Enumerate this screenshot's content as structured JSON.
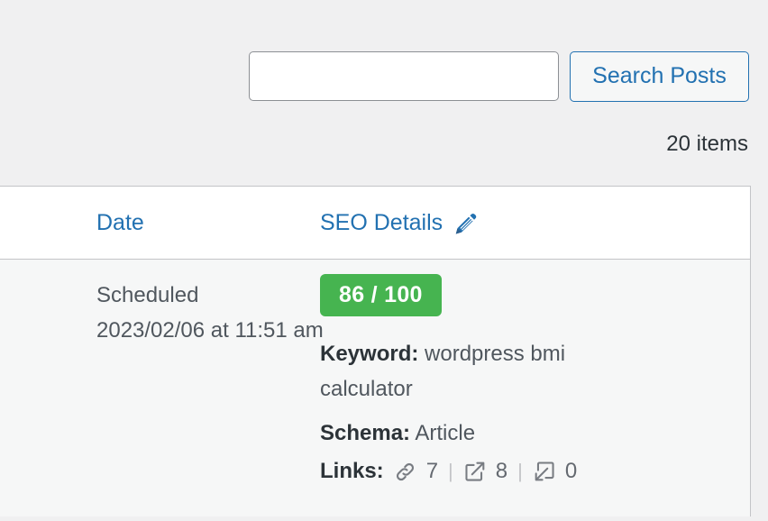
{
  "colors": {
    "page_background": "#f0f0f1",
    "link_blue": "#2271b1",
    "score_green": "#46b450",
    "border_gray": "#c3c4c7",
    "text_dark": "#2c3338",
    "text_gray": "#50575e"
  },
  "search": {
    "value": "",
    "placeholder": "",
    "button_label": "Search Posts"
  },
  "list": {
    "items_count_label": "20 items"
  },
  "table": {
    "columns": {
      "date_label": "Date",
      "seo_details_label": "SEO Details",
      "seo_edit_icon": "pencil-icon"
    },
    "rows": [
      {
        "date": {
          "status": "Scheduled",
          "value": "2023/02/06 at 11:51 am"
        },
        "seo": {
          "score": "86 / 100",
          "keyword_label": "Keyword:",
          "keyword_value": "wordpress bmi calculator",
          "schema_label": "Schema:",
          "schema_value": "Article",
          "links_label": "Links:",
          "links": [
            {
              "icon": "chain-link-icon",
              "count": "7"
            },
            {
              "icon": "external-link-icon",
              "count": "8"
            },
            {
              "icon": "inbound-link-icon",
              "count": "0"
            }
          ],
          "separator": "|"
        }
      }
    ]
  }
}
